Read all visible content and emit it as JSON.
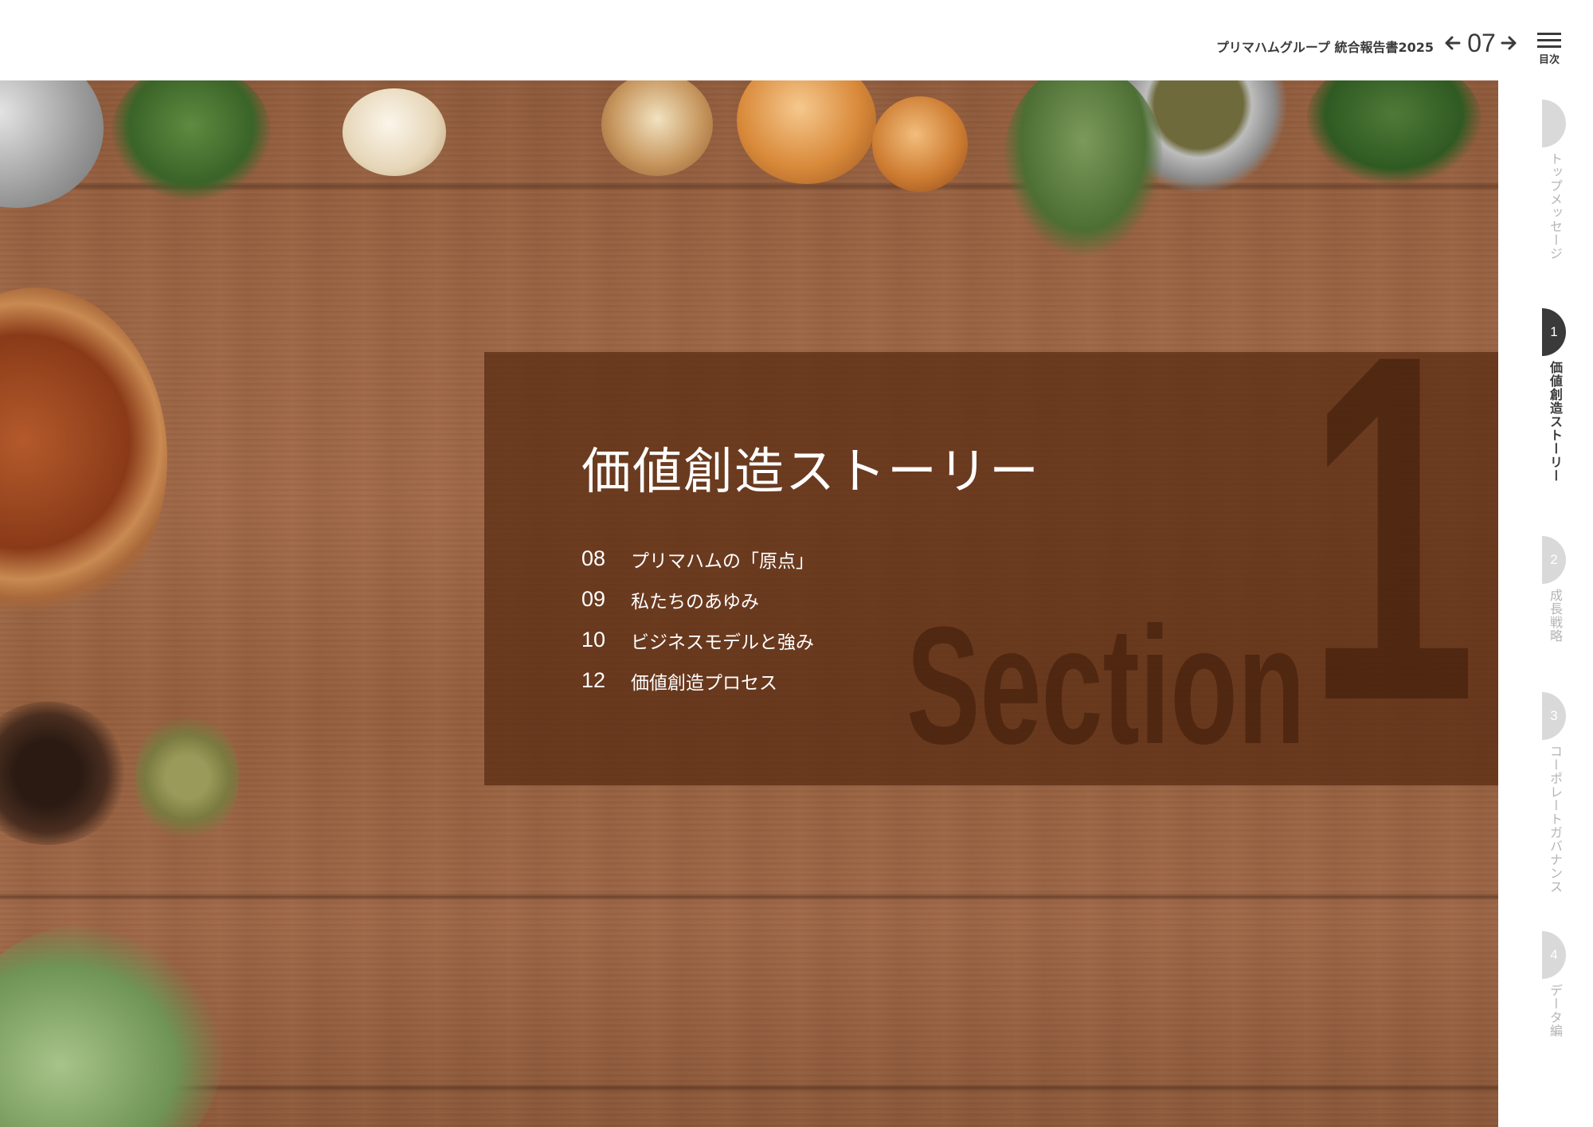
{
  "header": {
    "report_title": "プリマハムグループ 統合報告書2025",
    "page_number": "07",
    "menu_label": "目次"
  },
  "section": {
    "title": "価値創造ストーリー",
    "word": "Section",
    "number": "1",
    "toc": [
      {
        "page": "08",
        "label": "プリマハムの「原点」"
      },
      {
        "page": "09",
        "label": "私たちのあゆみ"
      },
      {
        "page": "10",
        "label": "ビジネスモデルと強み"
      },
      {
        "page": "12",
        "label": "価値創造プロセス"
      }
    ]
  },
  "side_nav": {
    "items": [
      {
        "number": "",
        "label": "トップメッセージ",
        "active": false
      },
      {
        "number": "1",
        "label": "価値創造ストーリー",
        "active": true
      },
      {
        "number": "2",
        "label": "成長戦略",
        "active": false
      },
      {
        "number": "3",
        "label": "コーポレートガバナンス",
        "active": false
      },
      {
        "number": "4",
        "label": "データ編",
        "active": false
      }
    ]
  },
  "colors": {
    "text_dark": "#3a3a3a",
    "wood_base": "#9a6444",
    "overlay": "#582a10",
    "nav_inactive": "#d9d9d9",
    "nav_active": "#3a3a3a"
  },
  "icons": [
    "arrow-left-icon",
    "arrow-right-icon",
    "hamburger-menu-icon"
  ]
}
